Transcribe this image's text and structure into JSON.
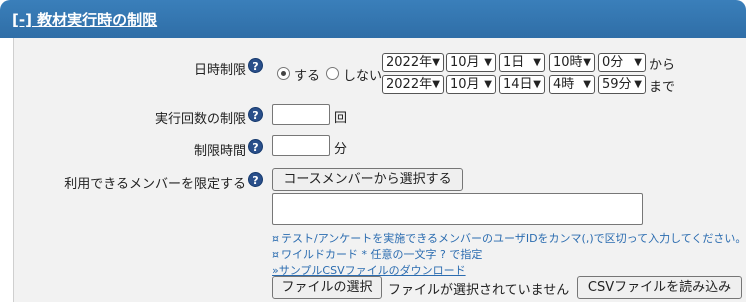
{
  "section": {
    "title": "[-] 教材実行時の制限"
  },
  "date_limit": {
    "label": "日時制限",
    "help_icon": "question-help-icon",
    "on_label": "する",
    "off_label": "しない",
    "selected": "on",
    "start": {
      "year": "2022年",
      "month": "10月",
      "day": "1日",
      "hour": "10時",
      "minute": "0分",
      "suffix": "から"
    },
    "end": {
      "year": "2022年",
      "month": "10月",
      "day": "14日",
      "hour": "4時",
      "minute": "59分",
      "suffix": "まで"
    }
  },
  "exec_count": {
    "label": "実行回数の制限",
    "value": "",
    "unit": "回"
  },
  "time_limit": {
    "label": "制限時間",
    "value": "",
    "unit": "分"
  },
  "members": {
    "label": "利用できるメンバーを限定する",
    "course_button": "コースメンバーから選択する",
    "textarea_value": "",
    "note1": "テスト/アンケートを実施できるメンバーのユーザIDをカンマ(,)で区切って入力してください。",
    "note2": "ワイルドカード * 任意の一文字 ? で指定",
    "csv_link": "»サンプルCSVファイルのダウンロード",
    "file_button": "ファイルの選択",
    "file_status": "ファイルが選択されていません",
    "load_button": "CSVファイルを読み込み",
    "bullet": "¤"
  },
  "colors": {
    "header": "#3a7fba",
    "panel": "#f2f2f2",
    "link": "#2b6cb0"
  }
}
